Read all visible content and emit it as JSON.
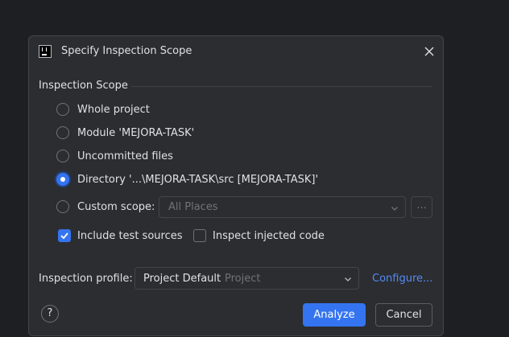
{
  "dialog": {
    "title": "Specify Inspection Scope",
    "icon": "intellij-app-icon"
  },
  "scope": {
    "section_label": "Inspection Scope",
    "options": [
      {
        "label": "Whole project",
        "selected": false
      },
      {
        "label": "Module 'MEJORA-TASK'",
        "selected": false
      },
      {
        "label": "Uncommitted files",
        "selected": false
      },
      {
        "label": "Directory '...\\MEJORA-TASK\\src [MEJORA-TASK]'",
        "selected": true
      },
      {
        "label": "Custom scope:",
        "selected": false
      }
    ],
    "custom_scope_value": "All Places",
    "custom_scope_more": "...",
    "include_test_sources": {
      "label": "Include test sources",
      "checked": true
    },
    "inspect_injected_code": {
      "label": "Inspect injected code",
      "checked": false
    }
  },
  "profile": {
    "label": "Inspection profile:",
    "value": "Project Default",
    "value_hint": "Project",
    "configure_link": "Configure..."
  },
  "footer": {
    "help": "?",
    "analyze": "Analyze",
    "cancel": "Cancel"
  },
  "colors": {
    "accent": "#3574f0",
    "link": "#548af7",
    "background": "#2b2d30"
  }
}
